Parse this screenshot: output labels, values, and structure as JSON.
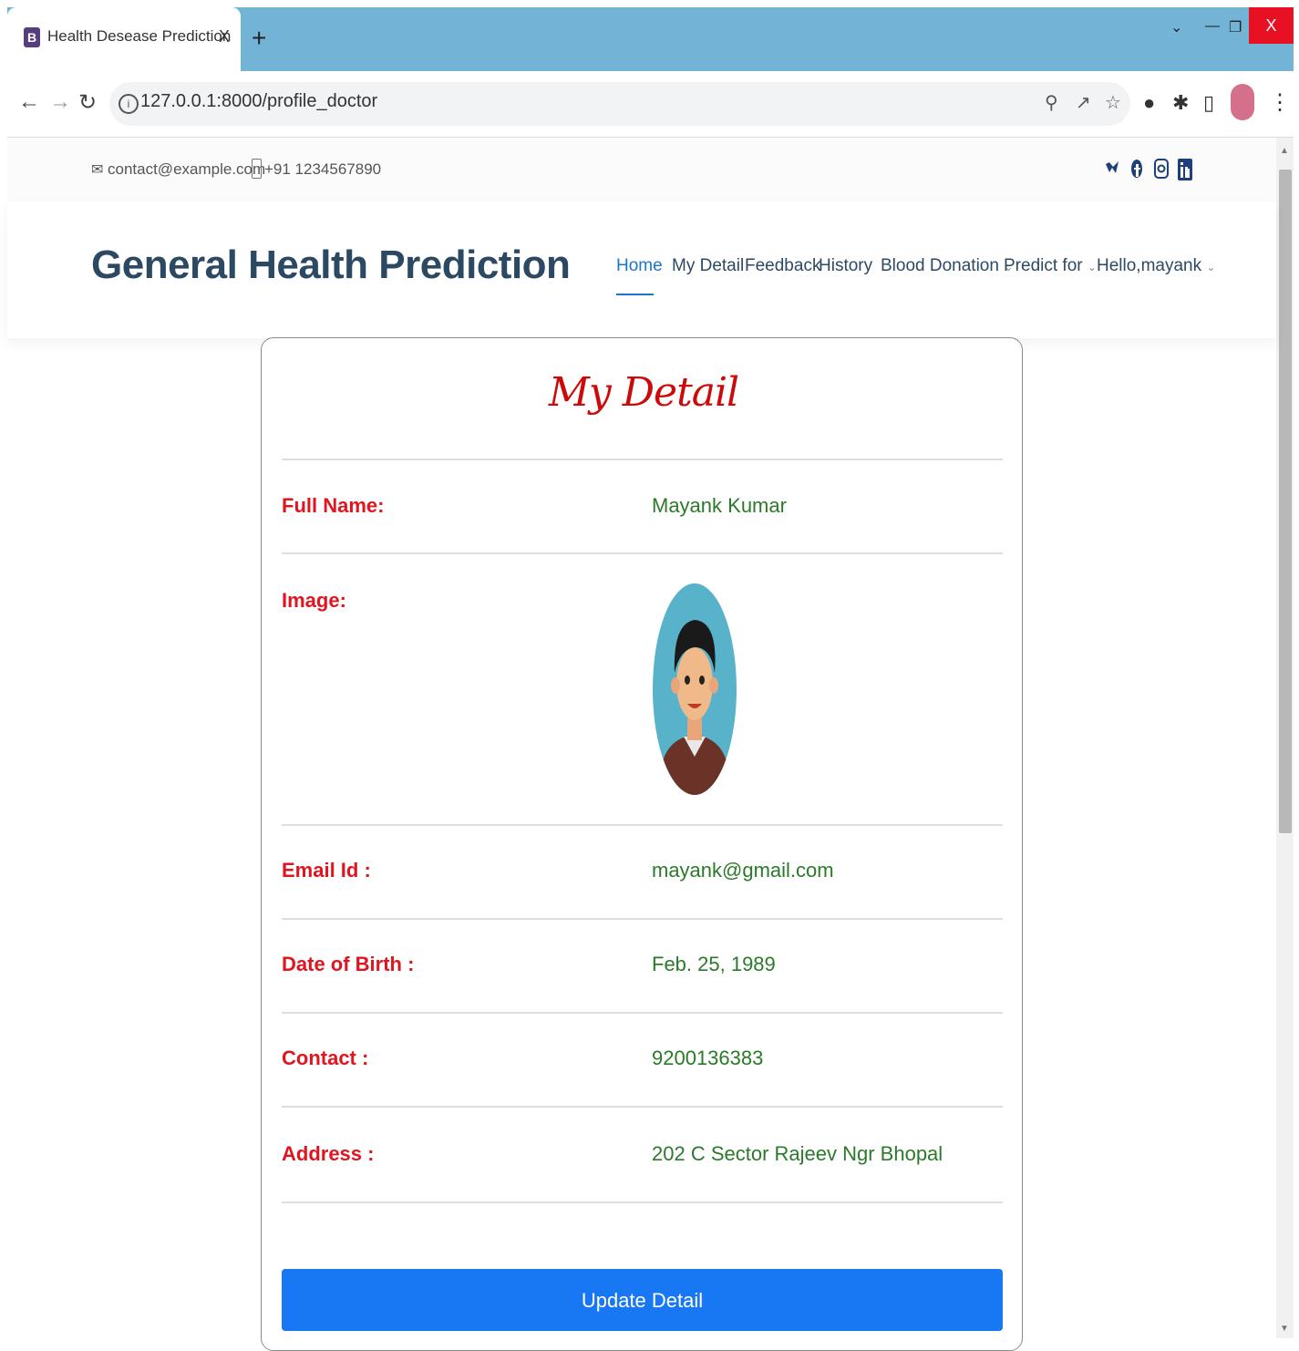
{
  "browser": {
    "tab_favicon": "B",
    "tab_title": "Health Desease Prediction",
    "tab_close": "X",
    "new_tab": "+",
    "url": "127.0.0.1:8000/profile_doctor",
    "window_close": "X"
  },
  "topbar": {
    "email": "contact@example.com",
    "phone": "+91 1234567890",
    "social": [
      "twitter-icon",
      "facebook-icon",
      "instagram-icon",
      "linkedin-icon"
    ]
  },
  "header": {
    "logo": "General Health Prediction",
    "nav": {
      "home": "Home",
      "my_detail": "My Detail",
      "feedback": "Feedback",
      "history": "History",
      "blood_donation": "Blood Donation",
      "predict_for": "Predict for",
      "user": "Hello,mayank"
    }
  },
  "profile": {
    "title": "My Detail",
    "full_name_label": "Full Name:",
    "full_name": "Mayank Kumar",
    "image_label": "Image:",
    "email_label": "Email Id :",
    "email": "mayank@gmail.com",
    "dob_label": "Date of Birth :",
    "dob": "Feb. 25, 1989",
    "contact_label": "Contact :",
    "contact": "9200136383",
    "address_label": "Address :",
    "address": "202 C Sector Rajeev Ngr Bhopal",
    "update_button": "Update Detail"
  },
  "colors": {
    "accent": "#1977cc",
    "label": "#e0151f",
    "value": "#2a7a2a",
    "button": "#1877f2",
    "title": "#cc0a0a"
  }
}
